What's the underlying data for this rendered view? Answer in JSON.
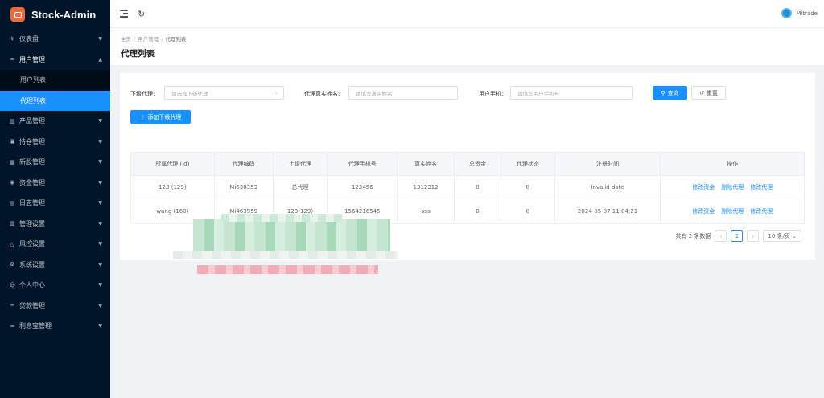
{
  "app": {
    "title": "Stock-Admin"
  },
  "sidebar": {
    "items_top": [
      {
        "icon": "dashboard-icon",
        "glyph": "⚘",
        "label": "仪表盘"
      }
    ],
    "open_group": {
      "icon": "user-group-icon",
      "glyph": "♒",
      "label": "用户管理"
    },
    "sub_items": [
      {
        "label": "用户列表",
        "active": false
      },
      {
        "label": "代理列表",
        "active": true
      }
    ],
    "items_bottom": [
      {
        "icon": "chart-bar-icon",
        "glyph": "▥",
        "label": "产品管理"
      },
      {
        "icon": "holdings-icon",
        "glyph": "▣",
        "label": "持仓管理"
      },
      {
        "icon": "ipo-icon",
        "glyph": "▦",
        "label": "新股管理"
      },
      {
        "icon": "money-icon",
        "glyph": "◉",
        "label": "资金管理"
      },
      {
        "icon": "log-icon",
        "glyph": "▤",
        "label": "日志管理"
      },
      {
        "icon": "settings-grid-icon",
        "glyph": "▧",
        "label": "管理设置"
      },
      {
        "icon": "warning-icon",
        "glyph": "△",
        "label": "风控设置"
      },
      {
        "icon": "gear-icon",
        "glyph": "⚙",
        "label": "系统设置"
      },
      {
        "icon": "person-icon",
        "glyph": "☺",
        "label": "个人中心"
      },
      {
        "icon": "loan-icon",
        "glyph": "♒",
        "label": "贷款管理"
      },
      {
        "icon": "treasure-icon",
        "glyph": "♒",
        "label": "利息宝管理"
      }
    ]
  },
  "header": {
    "user_name": "Mitrade"
  },
  "breadcrumb": {
    "home": "主页",
    "section": "用户管理",
    "current": "代理列表"
  },
  "page": {
    "title": "代理列表"
  },
  "filters": {
    "sub_agent_label": "下级代理:",
    "sub_agent_placeholder": "请选择下级代理",
    "real_name_label": "代理真实姓名:",
    "real_name_placeholder": "请填写真实姓名",
    "phone_label": "用户手机:",
    "phone_placeholder": "请填写用户手机号",
    "search_label": "查询",
    "reset_label": "重置",
    "add_label": "添加下级代理"
  },
  "table": {
    "columns": [
      "所属代理 (Id)",
      "代理编码",
      "上级代理",
      "代理手机号",
      "真实姓名",
      "总资金",
      "代理状态",
      "注册时间",
      "操作"
    ],
    "rows": [
      {
        "cells": [
          "123 (129)",
          "Mi638353",
          "总代理",
          "123456",
          "1312312",
          "0",
          "0",
          "Invalid date"
        ]
      },
      {
        "cells": [
          "wang (160)",
          "Mi463959",
          "123(129)",
          "1564216545",
          "sss",
          "0",
          "0",
          "2024-05-07 11:04:21"
        ]
      }
    ],
    "actions": [
      "修改资金",
      "删除代理",
      "修改代理"
    ]
  },
  "pagination": {
    "total_text": "共有 2 条数据",
    "current_page": "1",
    "page_size": "10 条/页"
  }
}
